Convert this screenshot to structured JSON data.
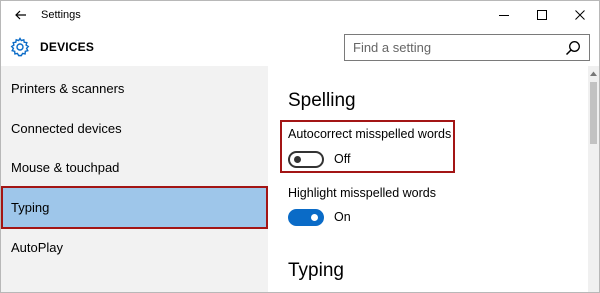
{
  "window": {
    "title": "Settings"
  },
  "header": {
    "title": "DEVICES",
    "search_placeholder": "Find a setting"
  },
  "sidebar": {
    "items": [
      {
        "label": "Printers & scanners"
      },
      {
        "label": "Connected devices"
      },
      {
        "label": "Mouse & touchpad"
      },
      {
        "label": "Typing",
        "selected": true
      },
      {
        "label": "AutoPlay"
      }
    ]
  },
  "content": {
    "spelling_title": "Spelling",
    "autocorrect": {
      "label": "Autocorrect misspelled words",
      "state": "Off"
    },
    "highlight": {
      "label": "Highlight misspelled words",
      "state": "On"
    },
    "typing_title": "Typing"
  },
  "colors": {
    "accent": "#0a6bc7",
    "selected_bg": "#9ec6ea",
    "highlight_border": "#a31515",
    "sidebar_bg": "#f2f2f2"
  },
  "icons": {
    "back": "back-arrow-icon",
    "header": "gear-icon",
    "search": "search-icon",
    "minimize": "minimize-icon",
    "maximize": "maximize-icon",
    "close": "close-icon"
  }
}
